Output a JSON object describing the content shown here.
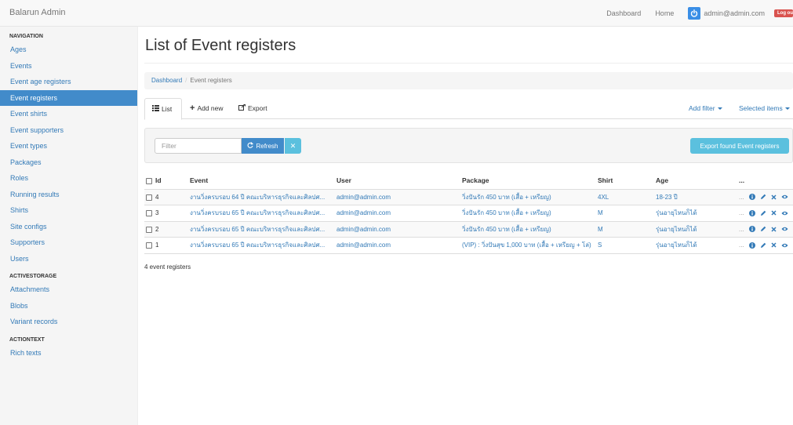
{
  "navbar": {
    "brand": "Balarun Admin",
    "links": [
      "Dashboard",
      "Home"
    ],
    "user_email": "admin@admin.com",
    "logout_label": "Log out"
  },
  "sidebar": {
    "sections": [
      {
        "header": "Navigation",
        "items": [
          "Ages",
          "Events",
          "Event age registers",
          "Event registers",
          "Event shirts",
          "Event supporters",
          "Event types",
          "Packages",
          "Roles",
          "Running results",
          "Shirts",
          "Site configs",
          "Supporters",
          "Users"
        ]
      },
      {
        "header": "Activestorage",
        "items": [
          "Attachments",
          "Blobs",
          "Variant records"
        ]
      },
      {
        "header": "Actiontext",
        "items": [
          "Rich texts"
        ]
      }
    ],
    "active_item": "Event registers"
  },
  "main": {
    "title": "List of Event registers",
    "breadcrumb": {
      "root": "Dashboard",
      "current": "Event registers"
    },
    "tabs": {
      "list": "List",
      "add_new": "Add new",
      "export": "Export",
      "add_filter": "Add filter",
      "selected_items": "Selected items"
    },
    "filter": {
      "placeholder": "Filter",
      "refresh": "Refresh",
      "export_found": "Export found Event registers"
    },
    "table": {
      "columns": [
        "Id",
        "Event",
        "User",
        "Package",
        "Shirt",
        "Age",
        "..."
      ],
      "rows": [
        {
          "id": "4",
          "event": "งานวิ่งครบรอบ 64 ปี คณะบริหารธุรกิจและศิลปศ...",
          "user": "admin@admin.com",
          "package": "วิ่งปันรัก 450 บาท (เสื้อ + เหรียญ)",
          "shirt": "4XL",
          "age": "18-23 ปี",
          "more": "..."
        },
        {
          "id": "3",
          "event": "งานวิ่งครบรอบ 65 ปี คณะบริหารธุรกิจและศิลปศ...",
          "user": "admin@admin.com",
          "package": "วิ่งปันรัก 450 บาท (เสื้อ + เหรียญ)",
          "shirt": "M",
          "age": "รุ่นอายุไหนก็ได้",
          "more": "..."
        },
        {
          "id": "2",
          "event": "งานวิ่งครบรอบ 65 ปี คณะบริหารธุรกิจและศิลปศ...",
          "user": "admin@admin.com",
          "package": "วิ่งปันรัก 450 บาท (เสื้อ + เหรียญ)",
          "shirt": "M",
          "age": "รุ่นอายุไหนก็ได้",
          "more": "..."
        },
        {
          "id": "1",
          "event": "งานวิ่งครบรอบ 65 ปี คณะบริหารธุรกิจและศิลปศ...",
          "user": "admin@admin.com",
          "package": "(VIP) : วิ่งปันสุข 1,000 บาท (เสื้อ + เหรียญ + โล่)",
          "shirt": "S",
          "age": "รุ่นอายุไหนก็ได้",
          "more": "..."
        }
      ]
    },
    "count_text": "4 event registers"
  },
  "colors": {
    "accent": "#428bca",
    "info": "#5bc0de",
    "danger": "#d9534f",
    "link": "#337ab7"
  },
  "icons": [
    "power-icon",
    "list-icon",
    "plus-icon",
    "export-icon",
    "refresh-icon",
    "close-icon",
    "info-icon",
    "pencil-icon",
    "delete-icon",
    "eye-icon",
    "caret-down-icon"
  ]
}
